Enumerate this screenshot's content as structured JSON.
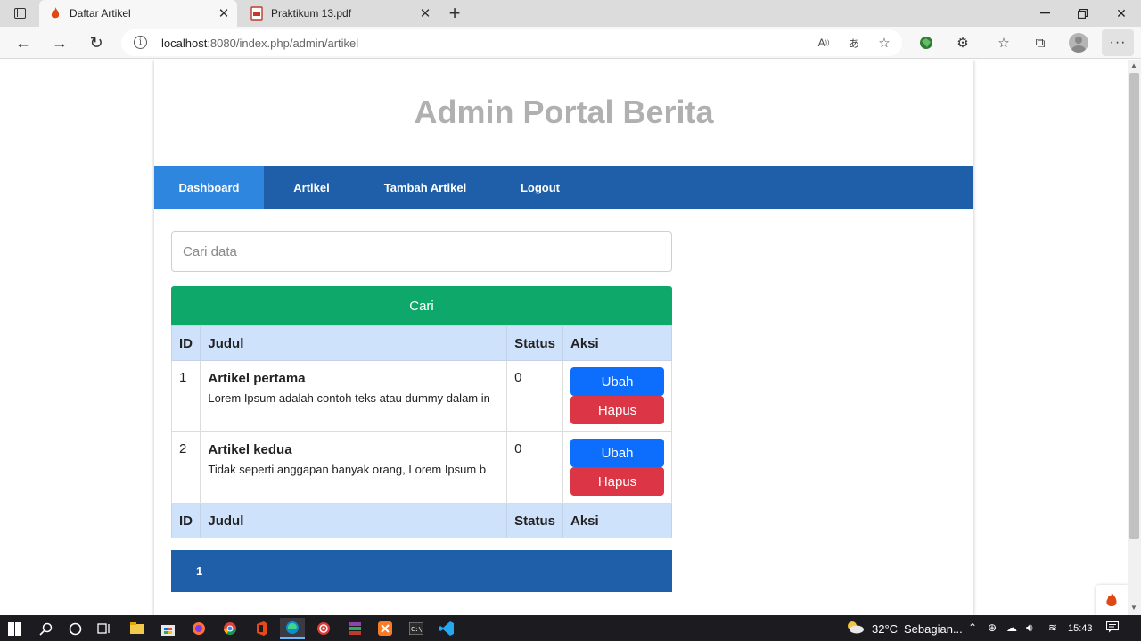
{
  "browser": {
    "tabs": [
      {
        "title": "Daftar Artikel",
        "active": true
      },
      {
        "title": "Praktikum 13.pdf",
        "active": false
      }
    ],
    "url_host": "localhost",
    "url_rest": ":8080/index.php/admin/artikel"
  },
  "page": {
    "site_title": "Admin Portal Berita",
    "nav": [
      "Dashboard",
      "Artikel",
      "Tambah Artikel",
      "Logout"
    ],
    "search_placeholder": "Cari data",
    "search_button": "Cari",
    "table_headers": [
      "ID",
      "Judul",
      "Status",
      "Aksi"
    ],
    "rows": [
      {
        "id": "1",
        "title": "Artikel pertama",
        "excerpt": "Lorem Ipsum adalah contoh teks atau dummy dalam in",
        "status": "0",
        "edit": "Ubah",
        "delete": "Hapus"
      },
      {
        "id": "2",
        "title": "Artikel kedua",
        "excerpt": "Tidak seperti anggapan banyak orang, Lorem Ipsum b",
        "status": "0",
        "edit": "Ubah",
        "delete": "Hapus"
      }
    ],
    "pagination_current": "1"
  },
  "taskbar": {
    "weather": "32°C",
    "weather_desc": "Sebagian...",
    "time": "15:43"
  },
  "colors": {
    "nav_bg": "#1f5faa",
    "nav_active": "#2e86de",
    "search_btn": "#0ea86b",
    "table_head": "#cfe2fb",
    "btn_edit": "#0d6efd",
    "btn_delete": "#dc3545"
  }
}
